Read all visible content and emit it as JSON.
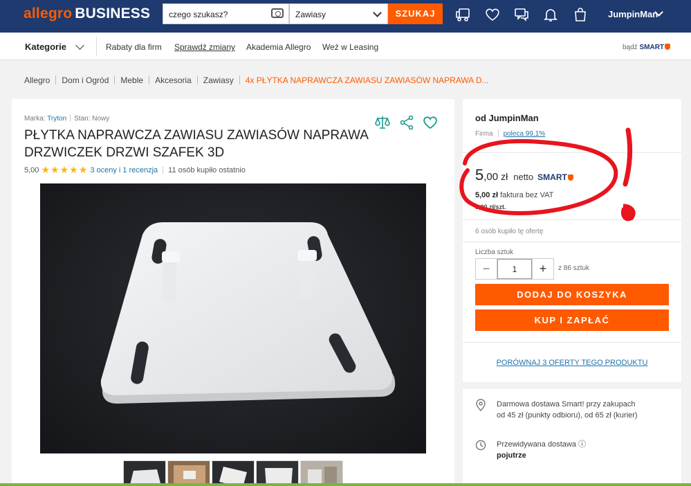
{
  "header": {
    "logo_brand": "allegro",
    "logo_product": "BUSINESS",
    "search_placeholder": "czego szukasz?",
    "category_value": "Zawiasy",
    "search_button": "SZUKAJ",
    "username": "JumpinMan",
    "icons": [
      "truck-icon",
      "heart-icon",
      "chat-icon",
      "bell-icon",
      "cart-icon"
    ]
  },
  "nav": {
    "kategorie": "Kategorie",
    "links": [
      "Rabaty dla firm",
      "Sprawdź zmiany",
      "Akademia Allegro",
      "Weź w Leasing"
    ],
    "smart_prefix": "bądź",
    "smart_label": "SMART"
  },
  "breadcrumb": [
    "Allegro",
    "Dom i Ogród",
    "Meble",
    "Akcesoria",
    "Zawiasy",
    "4x PŁYTKA NAPRAWCZA ZAWIASU ZAWIASÓW NAPRAWA D..."
  ],
  "product": {
    "brand_label": "Marka:",
    "brand_value": "Tryton",
    "condition_label": "Stan:",
    "condition_value": "Nowy",
    "title": "PŁYTKA NAPRAWCZA ZAWIASU ZAWIASÓW NAPRAWA DRZWICZEK DRZWI SZAFEK 3D",
    "rating_value": "5,00",
    "stars": "★★★★★",
    "rating_link": "3 oceny i 1 recenzja",
    "bought_recent": "11 osób kupiło ostatnio",
    "thumbnails_count": 5
  },
  "offer": {
    "seller": "od JumpinMan",
    "seller_type": "Firma",
    "recommend": "poleca 99,1%",
    "price_int": "5",
    "price_dec": ",00",
    "currency": "zł",
    "netto": "netto",
    "smart": "SMART",
    "vat_amount": "5,00 zł",
    "vat_label": "faktura bez VAT",
    "unit_price": "5,00 zł/szt.",
    "bought_offer": "6 osób kupiło tę ofertę",
    "qty_label": "Liczba sztuk",
    "qty_minus": "−",
    "qty_value": "1",
    "qty_plus": "+",
    "qty_of": "z 86 sztuk",
    "add_to_cart": "DODAJ DO KOSZYKA",
    "buy_now": "KUP I ZAPŁAĆ",
    "compare": "PORÓWNAJ 3 OFERTY TEGO PRODUKTU"
  },
  "delivery": {
    "free_line1": "Darmowa dostawa Smart! przy zakupach",
    "free_line2": "od 45 zł (punkty odbioru), od 65 zł (kurier)",
    "expected_label": "Przewidywana dostawa",
    "expected_info": "ⓘ",
    "expected_value": "pojutrze"
  },
  "colors": {
    "brand_orange": "#ff5a00",
    "header_navy": "#1e3a6e",
    "link_blue": "#1e73a8",
    "star_yellow": "#ffb400",
    "annotation_red": "#e8141e"
  }
}
